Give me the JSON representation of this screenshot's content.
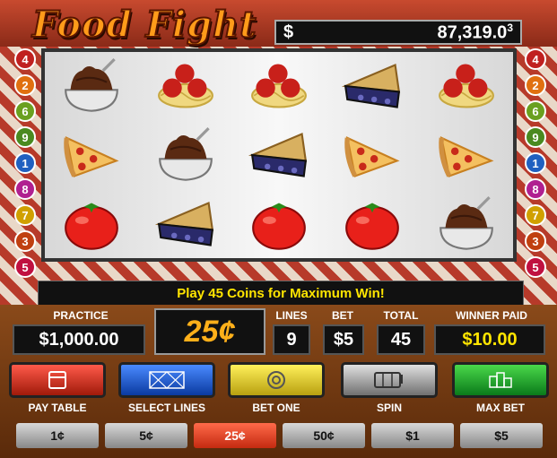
{
  "game": {
    "title": "Food Fight",
    "jackpot_currency": "$",
    "jackpot_value": "87,319.0",
    "jackpot_superscript": "3"
  },
  "reels": [
    [
      "chocolate-bowl",
      "spaghetti-meatballs",
      "spaghetti-meatballs",
      "blueberry-pie",
      "spaghetti-meatballs"
    ],
    [
      "pizza-slice",
      "chocolate-bowl",
      "blueberry-pie",
      "pizza-slice",
      "pizza-slice"
    ],
    [
      "tomato",
      "blueberry-pie",
      "tomato",
      "tomato",
      "chocolate-bowl"
    ]
  ],
  "lines_left": [
    "4",
    "2",
    "6",
    "9",
    "1",
    "8",
    "7",
    "3",
    "5"
  ],
  "lines_right": [
    "4",
    "2",
    "6",
    "9",
    "1",
    "8",
    "7",
    "3",
    "5"
  ],
  "line_colors": [
    "#c02020",
    "#e07010",
    "#6aa020",
    "#4a8a20",
    "#2060c0",
    "#b02090",
    "#d0a000",
    "#c04010",
    "#c01040"
  ],
  "message": "Play 45 Coins for Maximum Win!",
  "meters": {
    "practice_label": "PRACTICE",
    "practice_value": "$1,000.00",
    "denomination": "25¢",
    "lines_label": "LINES",
    "lines_value": "9",
    "bet_label": "BET",
    "bet_value": "$5",
    "total_label": "TOTAL",
    "total_value": "45",
    "winner_label": "WINNER PAID",
    "winner_value": "$10.00"
  },
  "buttons": {
    "pay_table": "PAY TABLE",
    "select_lines": "SELECT LINES",
    "bet_one": "BET ONE",
    "spin": "SPIN",
    "max_bet": "MAX BET"
  },
  "coins": [
    "1¢",
    "5¢",
    "25¢",
    "50¢",
    "$1",
    "$5"
  ],
  "coins_active_index": 2,
  "colors": {
    "btn_red": "#d42a1a",
    "btn_blue": "#1a5ad4",
    "btn_yellow": "#e8d21a",
    "btn_gray": "#9a9a9a",
    "btn_green": "#1aa82a"
  }
}
